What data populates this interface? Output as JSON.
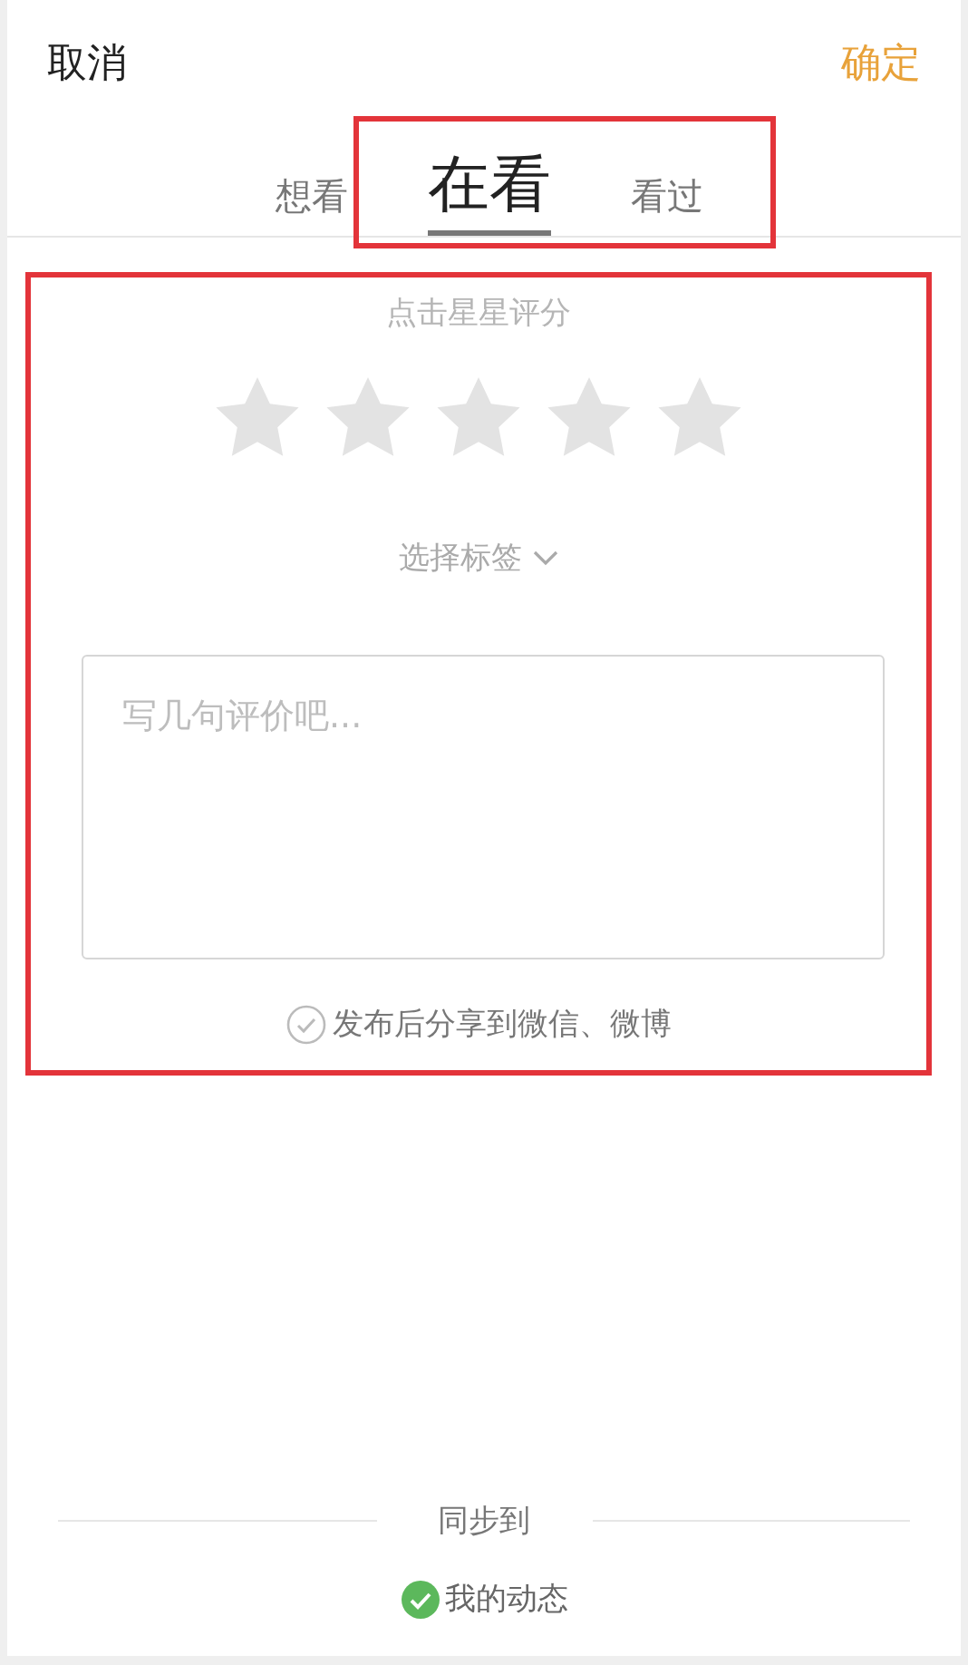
{
  "header": {
    "cancel": "取消",
    "confirm": "确定"
  },
  "tabs": {
    "highlighted": true,
    "items": [
      {
        "label": "想看",
        "selected": false
      },
      {
        "label": "在看",
        "selected": true
      },
      {
        "label": "看过",
        "selected": false
      }
    ]
  },
  "rating": {
    "highlighted": true,
    "hint": "点击星星评分",
    "stars": 0,
    "tag_selector": "选择标签",
    "review": {
      "placeholder": "写几句评价吧..."
    },
    "share": {
      "label": "发布后分享到微信、微博",
      "checked": false
    }
  },
  "sync": {
    "title": "同步到",
    "items": [
      {
        "label": "我的动态",
        "checked": true
      }
    ]
  }
}
